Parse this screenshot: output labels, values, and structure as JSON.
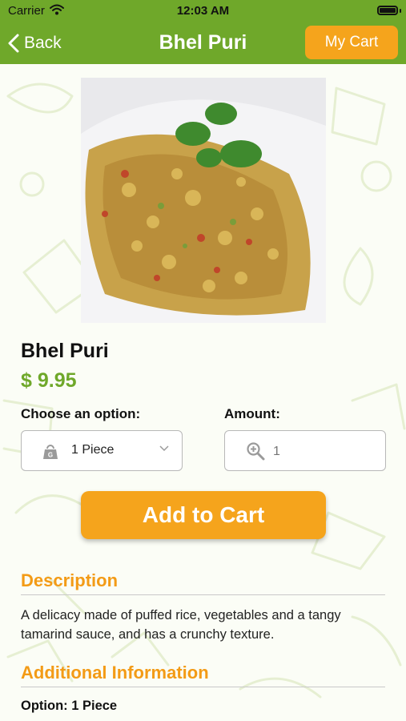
{
  "status_bar": {
    "carrier": "Carrier",
    "time": "12:03 AM"
  },
  "nav": {
    "back_label": "Back",
    "title": "Bhel Puri",
    "cart_label": "My Cart"
  },
  "product": {
    "name": "Bhel Puri",
    "price": "$ 9.95"
  },
  "options": {
    "choose_label": "Choose an option:",
    "selected": "1 Piece",
    "amount_label": "Amount:",
    "amount_placeholder": "1"
  },
  "add_to_cart_label": "Add to Cart",
  "description": {
    "title": "Description",
    "text": "A delicacy made of puffed rice, vegetables and a tangy tamarind sauce, and has a crunchy texture."
  },
  "additional": {
    "title": "Additional Information",
    "option_text": "Option: 1 Piece"
  },
  "colors": {
    "brand_green": "#6fa82a",
    "accent_orange": "#f5a41c",
    "heading_orange": "#f39b16"
  }
}
